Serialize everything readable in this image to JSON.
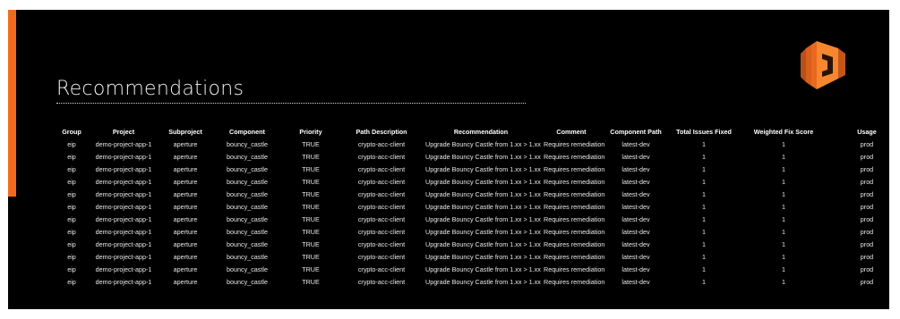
{
  "slide": {
    "title": "Recommendations",
    "accent_color": "#f26b1d",
    "background_color": "#000000",
    "logo_icon": "orange-bracket-logo-icon"
  },
  "table": {
    "headers": [
      "Group",
      "Project",
      "Subproject",
      "Component",
      "Priority",
      "Path Description",
      "Recommendation",
      "Comment",
      "Component Path",
      "Total Issues Fixed",
      "Weighted Fix Score",
      "Usage"
    ],
    "rows": [
      [
        "eip",
        "demo-project-app-1",
        "aperture",
        "bouncy_castle",
        "TRUE",
        "crypto-acc-client",
        "Upgrade Bouncy Castle from 1.xx > 1.xx",
        "Requires remediation",
        "latest-dev",
        "1",
        "1",
        "prod"
      ],
      [
        "eip",
        "demo-project-app-1",
        "aperture",
        "bouncy_castle",
        "TRUE",
        "crypto-acc-client",
        "Upgrade Bouncy Castle from 1.xx > 1.xx",
        "Requires remediation",
        "latest-dev",
        "1",
        "1",
        "prod"
      ],
      [
        "eip",
        "demo-project-app-1",
        "aperture",
        "bouncy_castle",
        "TRUE",
        "crypto-acc-client",
        "Upgrade Bouncy Castle from 1.xx > 1.xx",
        "Requires remediation",
        "latest-dev",
        "1",
        "1",
        "prod"
      ],
      [
        "eip",
        "demo-project-app-1",
        "aperture",
        "bouncy_castle",
        "TRUE",
        "crypto-acc-client",
        "Upgrade Bouncy Castle from 1.xx > 1.xx",
        "Requires remediation",
        "latest-dev",
        "1",
        "1",
        "prod"
      ],
      [
        "eip",
        "demo-project-app-1",
        "aperture",
        "bouncy_castle",
        "TRUE",
        "crypto-acc-client",
        "Upgrade Bouncy Castle from 1.xx > 1.xx",
        "Requires remediation",
        "latest-dev",
        "1",
        "1",
        "prod"
      ],
      [
        "eip",
        "demo-project-app-1",
        "aperture",
        "bouncy_castle",
        "TRUE",
        "crypto-acc-client",
        "Upgrade Bouncy Castle from 1.xx > 1.xx",
        "Requires remediation",
        "latest-dev",
        "1",
        "1",
        "prod"
      ],
      [
        "eip",
        "demo-project-app-1",
        "aperture",
        "bouncy_castle",
        "TRUE",
        "crypto-acc-client",
        "Upgrade Bouncy Castle from 1.xx > 1.xx",
        "Requires remediation",
        "latest-dev",
        "1",
        "1",
        "prod"
      ],
      [
        "eip",
        "demo-project-app-1",
        "aperture",
        "bouncy_castle",
        "TRUE",
        "crypto-acc-client",
        "Upgrade Bouncy Castle from 1.xx > 1.xx",
        "Requires remediation",
        "latest-dev",
        "1",
        "1",
        "prod"
      ],
      [
        "eip",
        "demo-project-app-1",
        "aperture",
        "bouncy_castle",
        "TRUE",
        "crypto-acc-client",
        "Upgrade Bouncy Castle from 1.xx > 1.xx",
        "Requires remediation",
        "latest-dev",
        "1",
        "1",
        "prod"
      ],
      [
        "eip",
        "demo-project-app-1",
        "aperture",
        "bouncy_castle",
        "TRUE",
        "crypto-acc-client",
        "Upgrade Bouncy Castle from 1.xx > 1.xx",
        "Requires remediation",
        "latest-dev",
        "1",
        "1",
        "prod"
      ],
      [
        "eip",
        "demo-project-app-1",
        "aperture",
        "bouncy_castle",
        "TRUE",
        "crypto-acc-client",
        "Upgrade Bouncy Castle from 1.xx > 1.xx",
        "Requires remediation",
        "latest-dev",
        "1",
        "1",
        "prod"
      ],
      [
        "eip",
        "demo-project-app-1",
        "aperture",
        "bouncy_castle",
        "TRUE",
        "crypto-acc-client",
        "Upgrade Bouncy Castle from 1.xx > 1.xx",
        "Requires remediation",
        "latest-dev",
        "1",
        "1",
        "prod"
      ]
    ]
  }
}
